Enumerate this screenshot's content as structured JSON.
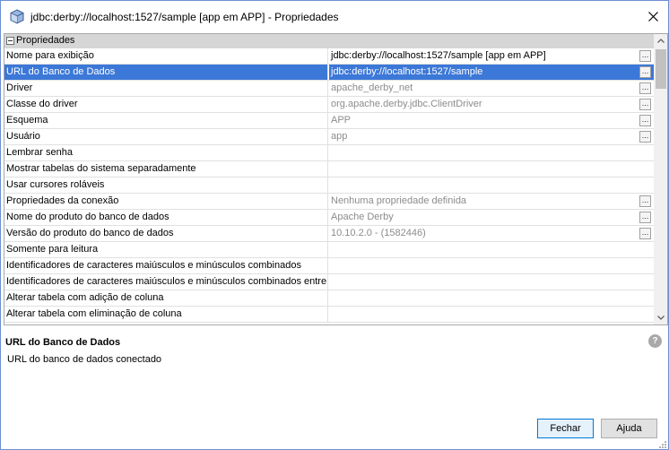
{
  "window": {
    "title": "jdbc:derby://localhost:1527/sample [app em APP] - Propriedades",
    "icon": "database-cube-icon",
    "close": "✕"
  },
  "sheet": {
    "category": "Propriedades",
    "rows": [
      {
        "name": "Nome para exibição",
        "value": "jdbc:derby://localhost:1527/sample [app em APP]",
        "kind": "text",
        "editable": true,
        "ellipsis": true
      },
      {
        "name": "URL do Banco de Dados",
        "value": "jdbc:derby://localhost:1527/sample",
        "kind": "text",
        "editable": false,
        "ellipsis": true,
        "selected": true
      },
      {
        "name": "Driver",
        "value": "apache_derby_net",
        "kind": "text",
        "editable": false,
        "ellipsis": true
      },
      {
        "name": "Classe do driver",
        "value": "org.apache.derby.jdbc.ClientDriver",
        "kind": "text",
        "editable": false,
        "ellipsis": true
      },
      {
        "name": "Esquema",
        "value": "APP",
        "kind": "text",
        "editable": false,
        "ellipsis": true
      },
      {
        "name": "Usuário",
        "value": "app",
        "kind": "text",
        "editable": false,
        "ellipsis": true
      },
      {
        "name": "Lembrar senha",
        "kind": "checkbox",
        "checked": true,
        "disabled": true
      },
      {
        "name": "Mostrar tabelas do sistema separadamente",
        "kind": "checkbox",
        "checked": false,
        "disabled": false
      },
      {
        "name": "Usar cursores roláveis",
        "kind": "checkbox",
        "checked": false,
        "disabled": false
      },
      {
        "name": "Propriedades da conexão",
        "value": "Nenhuma propriedade definida",
        "kind": "text",
        "editable": false,
        "ellipsis": true
      },
      {
        "name": "Nome do produto do banco de dados",
        "value": "Apache Derby",
        "kind": "text",
        "editable": false,
        "ellipsis": true
      },
      {
        "name": "Versão do produto do banco de dados",
        "value": "10.10.2.0 - (1582446)",
        "kind": "text",
        "editable": false,
        "ellipsis": true
      },
      {
        "name": "Somente para leitura",
        "kind": "checkbox",
        "checked": false,
        "disabled": true
      },
      {
        "name": "Identificadores de caracteres maiúsculos e minúsculos combinados",
        "kind": "checkbox",
        "checked": false,
        "disabled": true
      },
      {
        "name": "Identificadores de caracteres maiúsculos e minúsculos combinados entre aspas",
        "kind": "checkbox",
        "checked": true,
        "disabled": true
      },
      {
        "name": "Alterar tabela com adição de coluna",
        "kind": "checkbox",
        "checked": true,
        "disabled": true
      },
      {
        "name": "Alterar tabela com eliminação de coluna",
        "kind": "checkbox",
        "checked": true,
        "disabled": true
      }
    ],
    "ellipsis_label": "..."
  },
  "description": {
    "title": "URL do Banco de Dados",
    "text": "URL do banco de dados conectado",
    "help": "?"
  },
  "buttons": {
    "close": "Fechar",
    "help": "Ajuda"
  },
  "colors": {
    "selection": "#3c78d7",
    "category_bg": "#d6d6d6",
    "readonly_text": "#8c8c8c",
    "primary_border": "#0078d7"
  }
}
